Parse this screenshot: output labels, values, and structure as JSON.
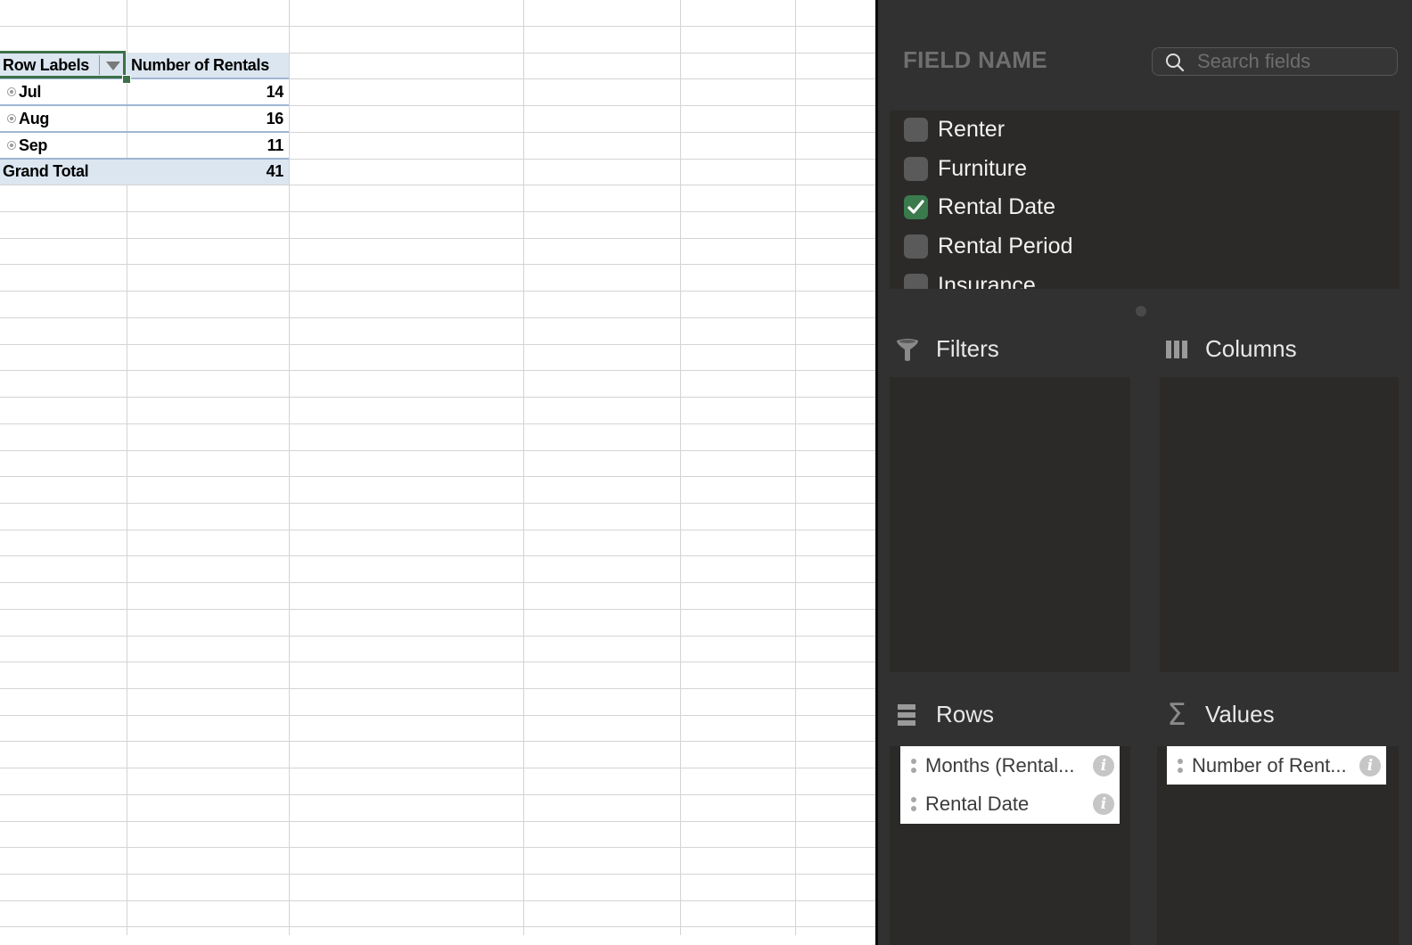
{
  "pivot_table": {
    "header": {
      "row_labels": "Row Labels",
      "value_field": "Number of Rentals"
    },
    "rows": [
      {
        "label": "Jul",
        "value": "14"
      },
      {
        "label": "Aug",
        "value": "16"
      },
      {
        "label": "Sep",
        "value": "11"
      }
    ],
    "grand_total": {
      "label": "Grand Total",
      "value": "41"
    }
  },
  "field_panel": {
    "title": "FIELD NAME",
    "search": {
      "placeholder": "Search fields",
      "value": ""
    },
    "fields": [
      {
        "label": "Renter",
        "checked": false
      },
      {
        "label": "Furniture",
        "checked": false
      },
      {
        "label": "Rental Date",
        "checked": true
      },
      {
        "label": "Rental Period",
        "checked": false
      },
      {
        "label": "Insurance",
        "checked": false
      }
    ],
    "areas": {
      "filters": {
        "label": "Filters",
        "items": []
      },
      "columns": {
        "label": "Columns",
        "items": []
      },
      "rows": {
        "label": "Rows",
        "items": [
          "Months (Rental...",
          "Rental Date"
        ]
      },
      "values": {
        "label": "Values",
        "items": [
          "Number of Rent..."
        ]
      }
    },
    "colors": {
      "checkbox_checked": "#3a7a4c",
      "panel_bg": "#313131",
      "selection_border": "#3d7049",
      "pivot_header_bg": "#dce6f0"
    }
  }
}
